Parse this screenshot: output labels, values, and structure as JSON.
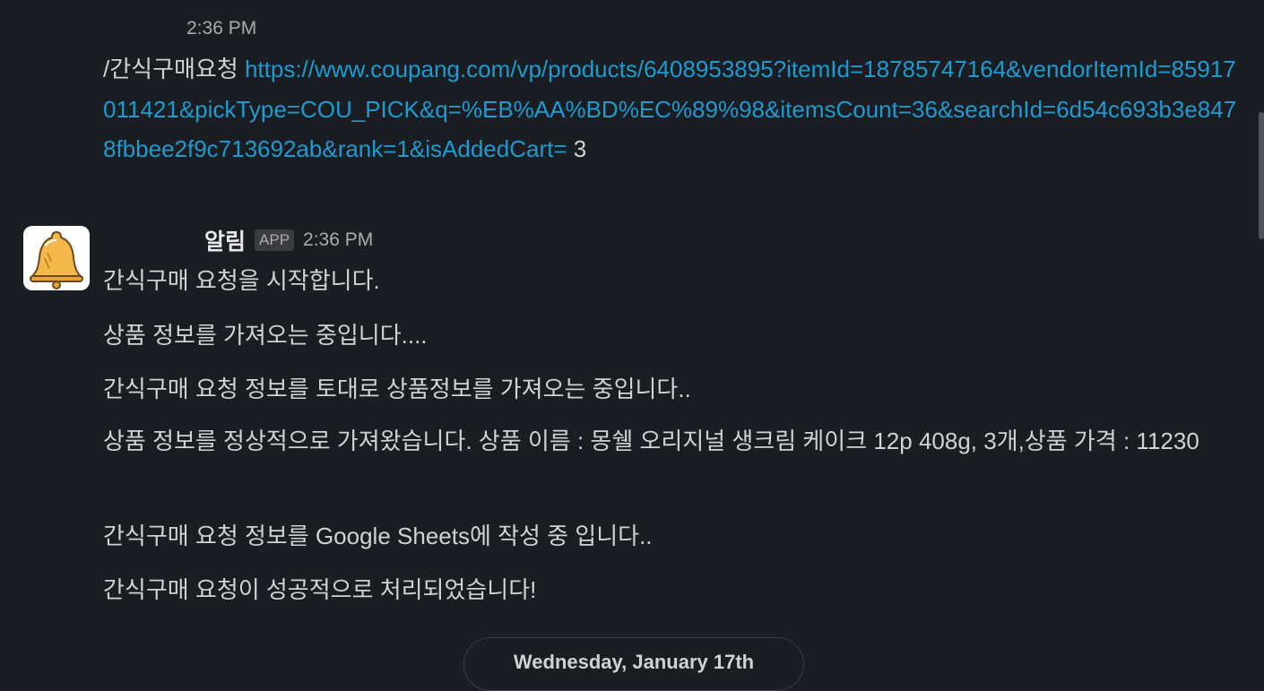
{
  "message1": {
    "time": "2:36 PM",
    "command": "/간식구매요청 ",
    "url": "https://www.coupang.com/vp/products/6408953895?itemId=18785747164&vendorItemId=85917011421&pickType=COU_PICK&q=%EB%AA%BD%EC%89%98&itemsCount=36&searchId=6d54c693b3e8478fbbee2f9c713692ab&rank=1&isAddedCart=",
    "suffix": " 3"
  },
  "message2": {
    "sender": "알림",
    "badge": "APP",
    "time": "2:36 PM",
    "avatar_icon": "bell-icon",
    "lines": [
      "간식구매 요청을 시작합니다.",
      "상품 정보를 가져오는 중입니다....",
      "간식구매 요청 정보를 토대로 상품정보를 가져오는 중입니다..",
      "상품 정보를 정상적으로 가져왔습니다. 상품 이름 : 몽쉘 오리지널 생크림 케이크 12p  408g, 3개,상품 가격 : 11230",
      "간식구매 요청 정보를 Google Sheets에 작성 중 입니다..",
      "간식구매 요청이 성공적으로 처리되었습니다!"
    ]
  },
  "date_divider": "Wednesday, January 17th",
  "colors": {
    "background": "#1a1d21",
    "text": "#d1d2d3",
    "link": "#1d9bd1",
    "muted": "#ababad"
  }
}
